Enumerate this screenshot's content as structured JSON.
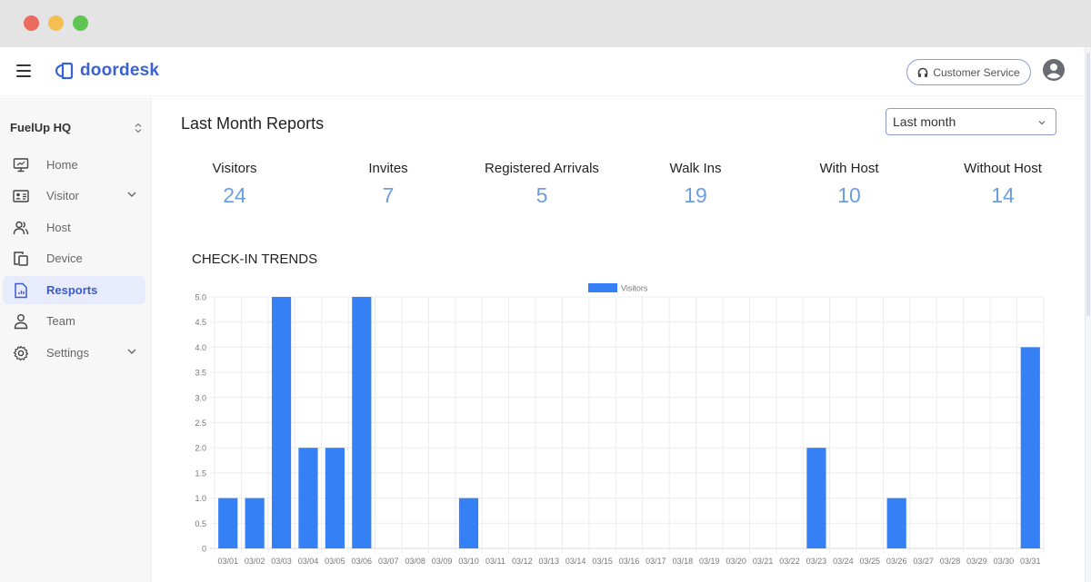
{
  "window": {
    "controls": [
      "close",
      "minimize",
      "maximize"
    ]
  },
  "header": {
    "brand": "doordesk",
    "brand_color": "#3a62d6",
    "customer_service_label": "Customer Service"
  },
  "sidebar": {
    "org_name": "FuelUp HQ",
    "items": [
      {
        "label": "Home",
        "icon": "monitor-icon",
        "active": false,
        "expandable": false
      },
      {
        "label": "Visitor",
        "icon": "id-card-icon",
        "active": false,
        "expandable": true
      },
      {
        "label": "Host",
        "icon": "users-icon",
        "active": false,
        "expandable": false
      },
      {
        "label": "Device",
        "icon": "devices-icon",
        "active": false,
        "expandable": false
      },
      {
        "label": "Resports",
        "icon": "report-icon",
        "active": true,
        "expandable": false
      },
      {
        "label": "Team",
        "icon": "user-icon",
        "active": false,
        "expandable": false
      },
      {
        "label": "Settings",
        "icon": "gear-icon",
        "active": false,
        "expandable": true
      }
    ]
  },
  "main": {
    "title": "Last Month Reports",
    "range_select": {
      "value": "Last month"
    },
    "stats": [
      {
        "label": "Visitors",
        "value": "24"
      },
      {
        "label": "Invites",
        "value": "7"
      },
      {
        "label": "Registered Arrivals",
        "value": "5"
      },
      {
        "label": "Walk Ins",
        "value": "19"
      },
      {
        "label": "With Host",
        "value": "10"
      },
      {
        "label": "Without Host",
        "value": "14"
      }
    ],
    "section_title": "CHECK-IN TRENDS"
  },
  "chart_data": {
    "type": "bar",
    "title": "",
    "xlabel": "",
    "ylabel": "",
    "legend": {
      "position": "top-center",
      "entries": [
        "Visitors"
      ]
    },
    "grid": true,
    "ylim": [
      0,
      5
    ],
    "yticks": [
      "0",
      "0.5",
      "1.0",
      "1.5",
      "2.0",
      "2.5",
      "3.0",
      "3.5",
      "4.0",
      "4.5",
      "5.0"
    ],
    "color": "#3580f5",
    "categories": [
      "03/01",
      "03/02",
      "03/03",
      "03/04",
      "03/05",
      "03/06",
      "03/07",
      "03/08",
      "03/09",
      "03/10",
      "03/11",
      "03/12",
      "03/13",
      "03/14",
      "03/15",
      "03/16",
      "03/17",
      "03/18",
      "03/19",
      "03/20",
      "03/21",
      "03/22",
      "03/23",
      "03/24",
      "03/25",
      "03/26",
      "03/27",
      "03/28",
      "03/29",
      "03/30",
      "03/31"
    ],
    "series": [
      {
        "name": "Visitors",
        "values": [
          1,
          1,
          5,
          2,
          2,
          5,
          0,
          0,
          0,
          1,
          0,
          0,
          0,
          0,
          0,
          0,
          0,
          0,
          0,
          0,
          0,
          0,
          2,
          0,
          0,
          1,
          0,
          0,
          0,
          0,
          4
        ]
      }
    ]
  }
}
